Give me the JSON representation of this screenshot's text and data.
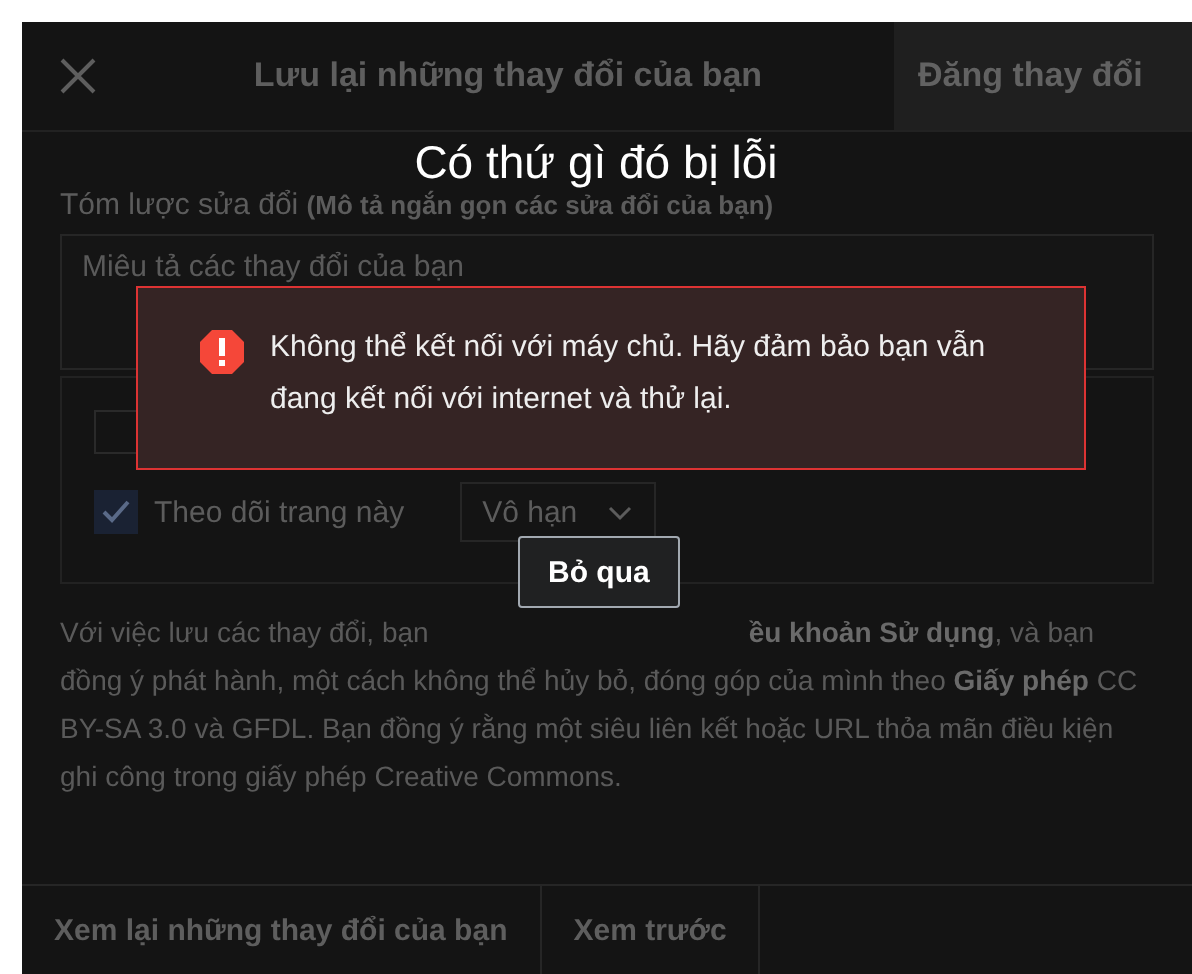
{
  "dialog": {
    "title": "Lưu lại những thay đổi của bạn",
    "primary_button": "Đăng thay đổi",
    "summary": {
      "label": "Tóm lược sửa đổi",
      "hint": "(Mô tả ngắn gọn các sửa đổi của bạn)",
      "placeholder": "Miêu tả các thay đổi của bạn"
    },
    "options": [
      {
        "kind": "checkbox",
        "checked": false
      },
      {
        "kind": "watch",
        "label": "Theo dõi trang này",
        "checked": true,
        "expiry": "Vô hạn"
      }
    ],
    "license": {
      "lead": "Với việc lưu các thay đổi, bạn",
      "rest": "**ều khoản Sử dụng**, và bạn đồng ý phát hành, một cách không thể hủy bỏ, đóng góp của mình theo **Giấy phép** CC BY-SA 3.0 và GFDL. Bạn đồng ý rằng một siêu liên kết hoặc URL thỏa mãn điều kiện ghi công trong giấy phép Creative Commons."
    },
    "footer_buttons": [
      "Xem lại những thay đổi của bạn",
      "Xem trước"
    ]
  },
  "error": {
    "title": "Có thứ gì đó bị lỗi",
    "message": "Không thể kết nối với máy chủ. Hãy đảm bảo bạn vẫn đang kết nối với internet và thử lại.",
    "dismiss": "Bỏ qua"
  }
}
